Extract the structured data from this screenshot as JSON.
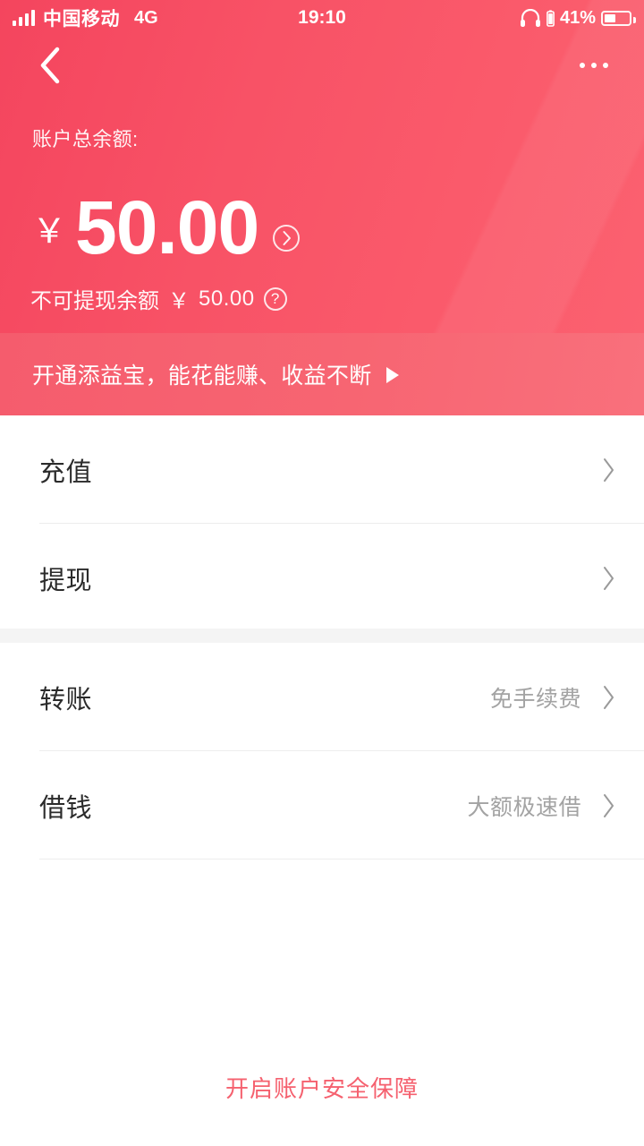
{
  "status_bar": {
    "carrier": "中国移动",
    "network": "4G",
    "time": "19:10",
    "battery_percent": "41%",
    "signal_bars": 4,
    "headphone_icon": "headphone-icon",
    "battery_icon": "battery-icon"
  },
  "nav": {
    "back_icon": "back-chevron-icon",
    "more_icon": "more-dots-icon"
  },
  "balance": {
    "label": "账户总余额:",
    "currency_symbol": "￥",
    "amount": "50.00",
    "detail_arrow_icon": "circle-chevron-right-icon",
    "sub_label": "不可提现余额",
    "sub_currency_symbol": "￥",
    "sub_amount": "50.00",
    "help_icon": "question-circle-icon",
    "help_glyph": "?"
  },
  "promo": {
    "text": "开通添益宝，能花能赚、收益不断",
    "play_icon": "play-triangle-icon"
  },
  "menu_groups": [
    {
      "rows": [
        {
          "title": "充值",
          "value": "",
          "chevron_icon": "chevron-right-icon"
        },
        {
          "title": "提现",
          "value": "",
          "chevron_icon": "chevron-right-icon"
        }
      ]
    },
    {
      "rows": [
        {
          "title": "转账",
          "value": "免手续费",
          "chevron_icon": "chevron-right-icon"
        },
        {
          "title": "借钱",
          "value": "大额极速借",
          "chevron_icon": "chevron-right-icon"
        }
      ]
    }
  ],
  "footer": {
    "link_text": "开启账户安全保障"
  },
  "colors": {
    "header_red": "#f85266",
    "promo_red": "#f76572",
    "accent_link": "#f5616f",
    "row_title": "#2b2b2b",
    "row_value": "#a3a3a3",
    "divider": "#ededed",
    "gap_band": "#f4f4f4"
  }
}
